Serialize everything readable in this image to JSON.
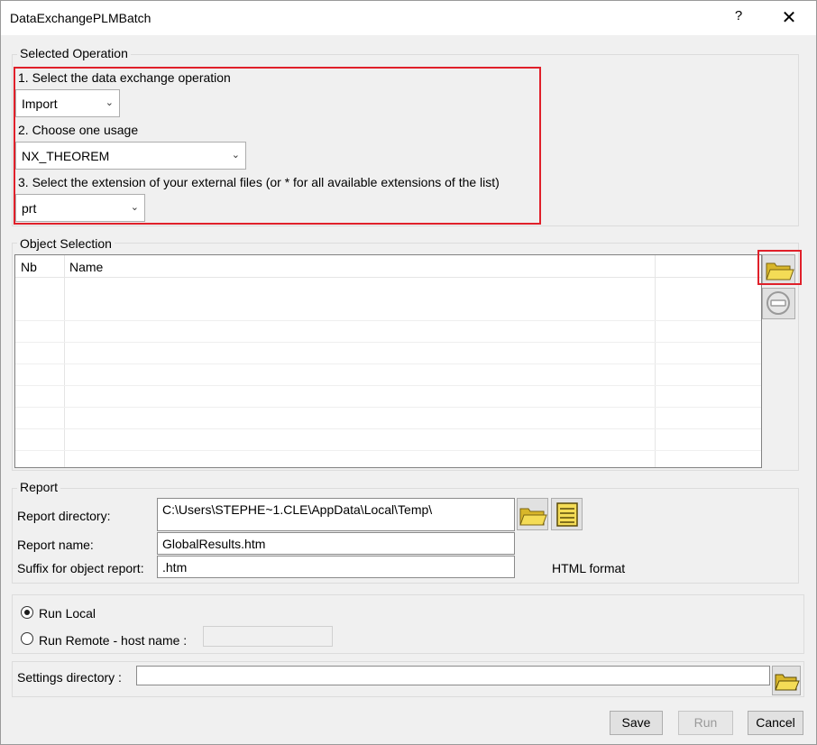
{
  "window": {
    "title": "DataExchangePLMBatch",
    "help": "?",
    "close": "✕"
  },
  "selected_operation": {
    "legend": "Selected Operation",
    "step1_label": "1. Select the data exchange operation",
    "operation_value": "Import",
    "step2_label": "2. Choose one usage",
    "usage_value": "NX_THEOREM",
    "step3_label": "3. Select the extension of your external files (or * for all available extensions of the list)",
    "extension_value": "prt"
  },
  "object_selection": {
    "legend": "Object Selection",
    "columns": [
      "Nb",
      "Name"
    ],
    "rows": []
  },
  "report": {
    "legend": "Report",
    "dir_label": "Report directory:",
    "dir_value": "C:\\Users\\STEPHE~1.CLE\\AppData\\Local\\Temp\\",
    "name_label": "Report name:",
    "name_value": "GlobalResults.htm",
    "suffix_label": "Suffix for object report:",
    "suffix_value": ".htm",
    "format_text": "HTML format"
  },
  "run": {
    "local_label": "Run Local",
    "remote_label": "Run Remote - host name :",
    "selected": "local",
    "host_value": ""
  },
  "settings": {
    "label": "Settings directory :",
    "value": ""
  },
  "buttons": {
    "save": "Save",
    "run": "Run",
    "cancel": "Cancel"
  },
  "colors": {
    "highlight": "#e0202a",
    "folder": "#f2d23c"
  }
}
